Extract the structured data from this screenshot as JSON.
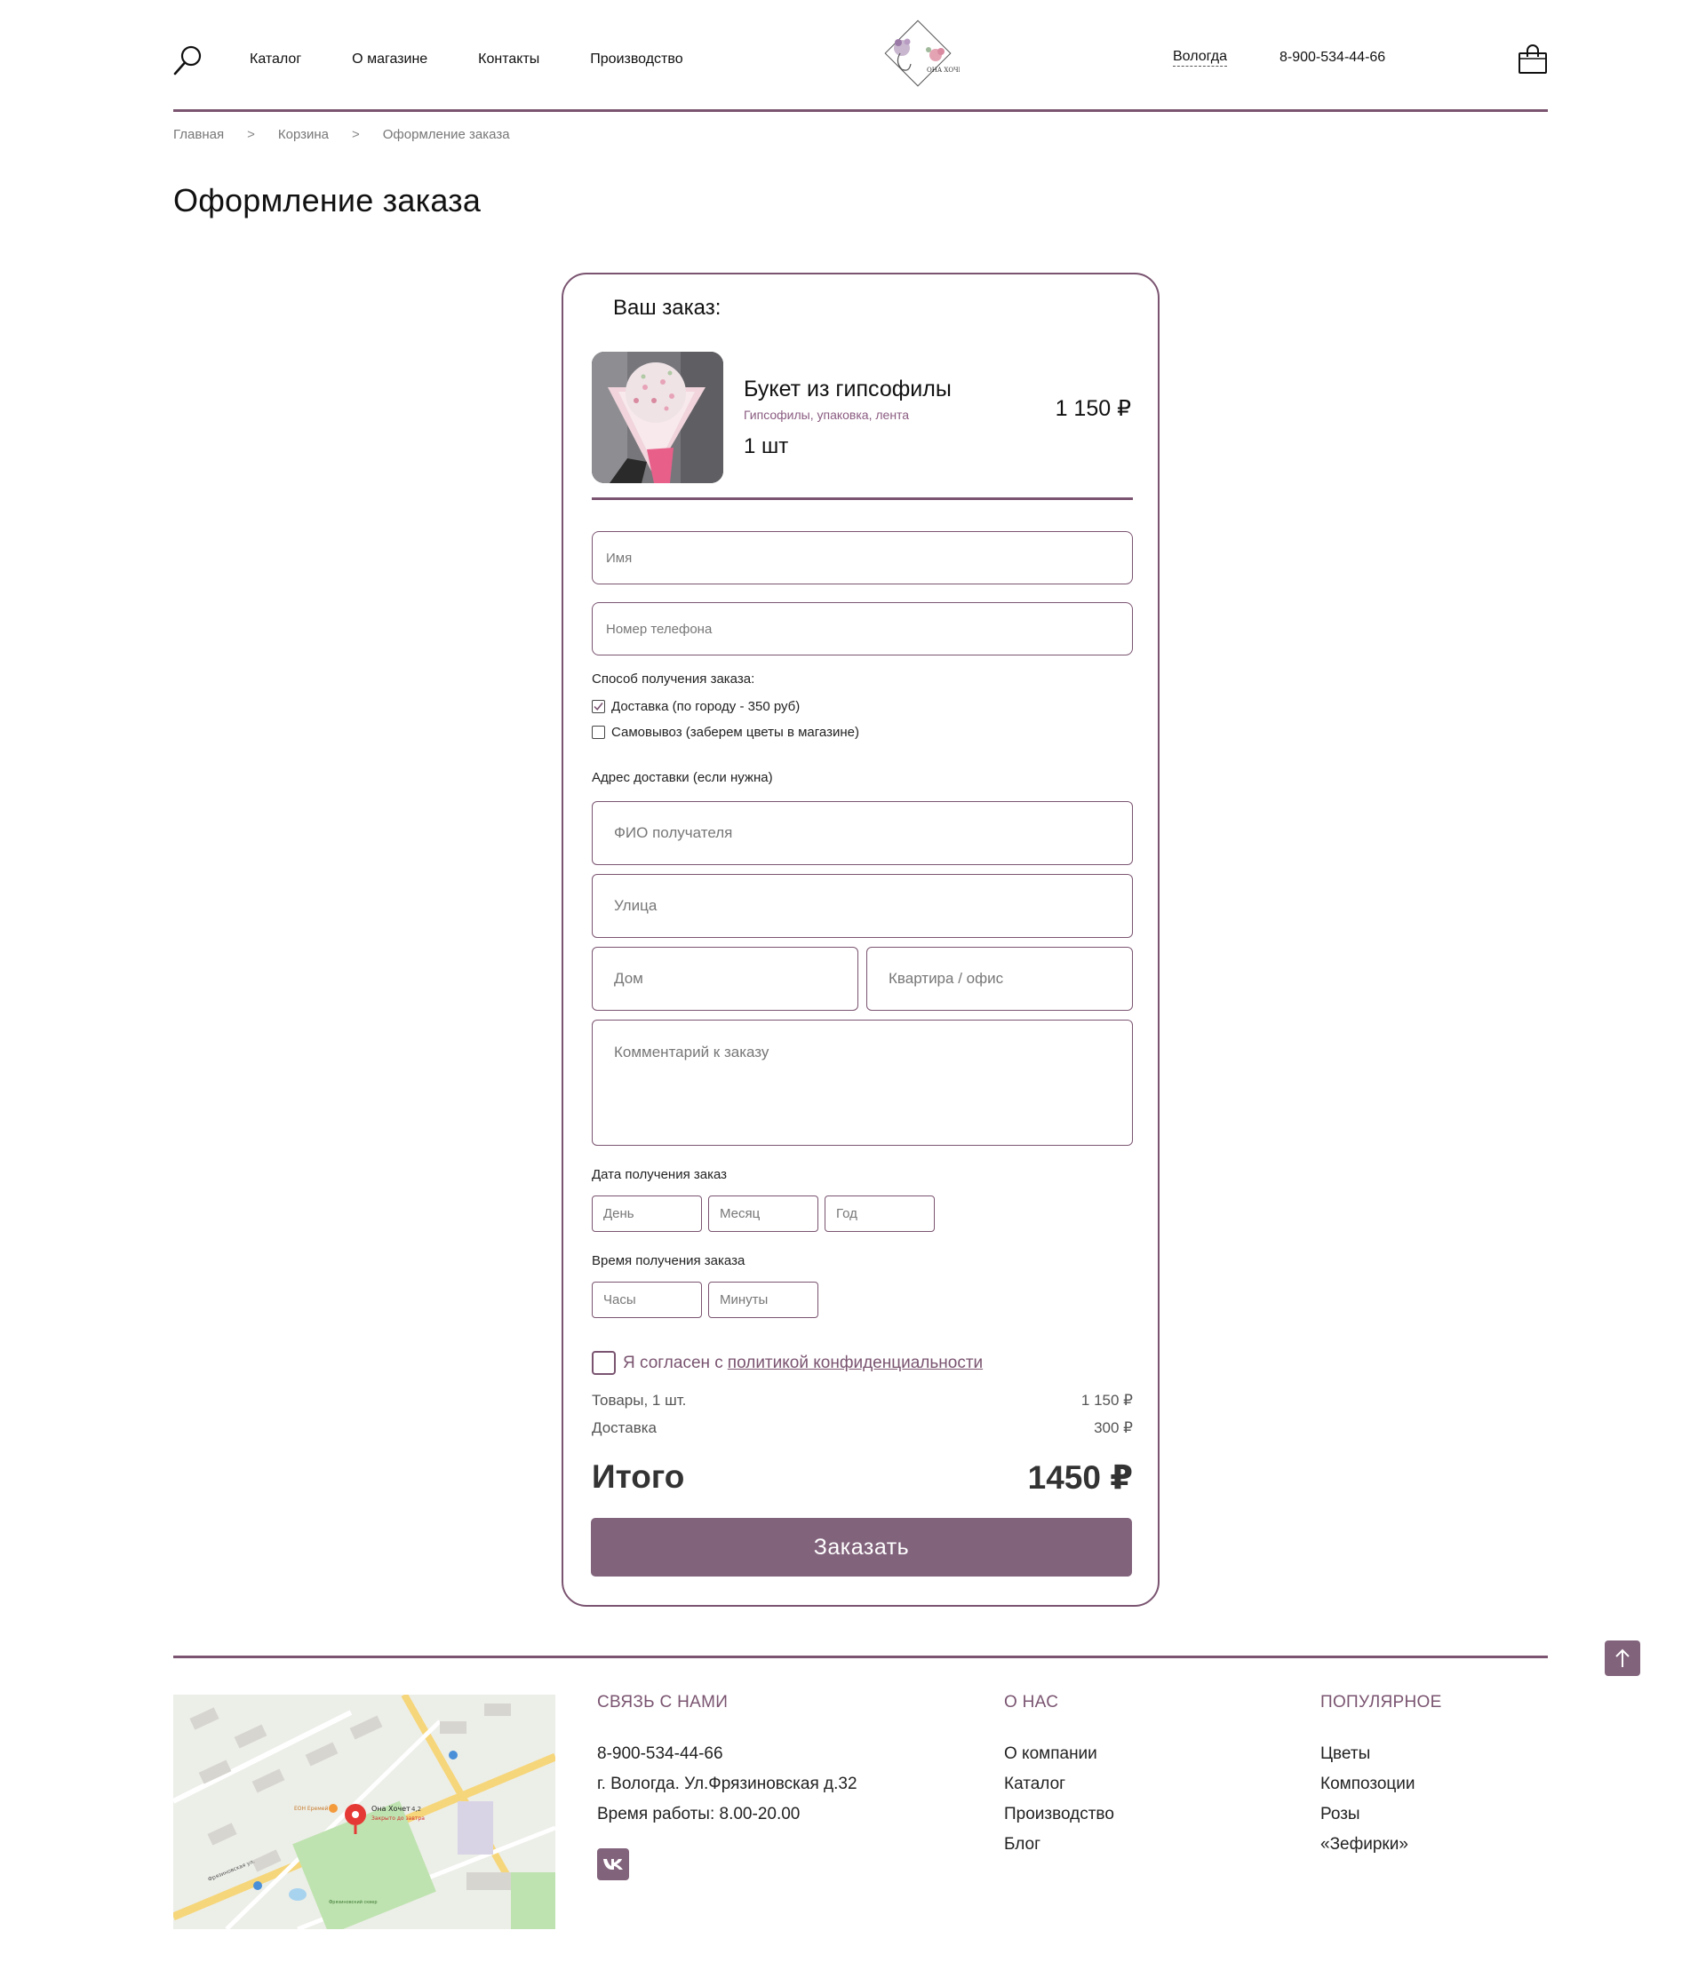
{
  "header": {
    "nav": [
      "Каталог",
      "О магазине",
      "Контакты",
      "Производство"
    ],
    "logo_text": "ОНА ХОЧЕТ",
    "city": "Вологда",
    "phone": "8-900-534-44-66"
  },
  "breadcrumb": [
    "Главная",
    "Корзина",
    "Оформление заказа"
  ],
  "page_title": "Оформление заказа",
  "order": {
    "title": "Ваш заказ:",
    "product": {
      "name": "Букет из гипсофилы",
      "desc": "Гипсофилы, упаковка, лента",
      "qty": "1 шт",
      "price": "1 150 ₽"
    },
    "fields": {
      "name": "Имя",
      "phone": "Номер телефона",
      "recipient": "ФИО получателя",
      "street": "Улица",
      "house": "Дом",
      "apartment": "Квартира / офис",
      "comment": "Комментарий к заказу",
      "day": "День",
      "month": "Месяц",
      "year": "Год",
      "hours": "Часы",
      "minutes": "Минуты"
    },
    "delivery_label": "Способ получения заказа:",
    "delivery_options": [
      {
        "label": "Доставка (по городу - 350 руб)",
        "checked": true
      },
      {
        "label": "Самовывоз (заберем цветы в магазине)",
        "checked": false
      }
    ],
    "address_label": "Адрес доставки (если нужна)",
    "date_label": "Дата получения заказ",
    "time_label": "Время получения заказа",
    "agree_text": "Я согласен с",
    "agree_link": "политикой конфиденциальности",
    "goods_label": "Товары, 1 шт.",
    "goods_value": "1  150 ₽",
    "delivery_sum_label": "Доставка",
    "delivery_sum_value": "300 ₽",
    "total_label": "Итого",
    "total_value": "1450 ₽",
    "submit": "Заказать"
  },
  "footer": {
    "contact": {
      "title": "СВЯЗЬ С НАМИ",
      "phone": "8-900-534-44-66",
      "address": "г. Вологда. Ул.Фрязиновская д.32",
      "hours": "Время работы: 8.00-20.00"
    },
    "about": {
      "title": "О НАС",
      "items": [
        "О компании",
        "Каталог",
        "Производство",
        "Блог"
      ]
    },
    "popular": {
      "title": "ПОПУЛЯРНОЕ",
      "items": [
        "Цветы",
        "Композоции",
        "Розы",
        "«Зефирки»"
      ]
    },
    "map_labels": {
      "place": "Она Хочет",
      "rating": "4,2",
      "status": "Закрыто до завтра",
      "shop": "ЕОН Еремей",
      "street": "Фрязиновская ул.",
      "park": "Фрязиновский сквер"
    }
  },
  "colors": {
    "accent": "#7a5470",
    "button": "#82637c"
  }
}
